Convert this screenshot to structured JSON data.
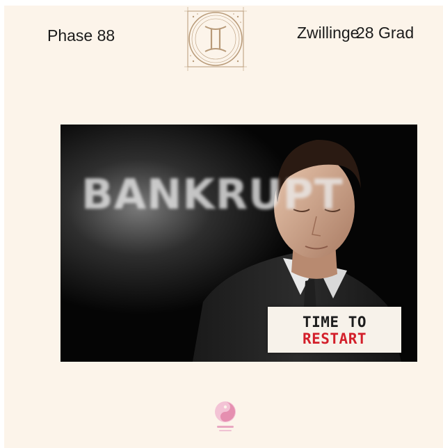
{
  "header": {
    "phase": "Phase 88",
    "sign": "Zwillinge",
    "degree": "28 Grad",
    "emblem_icon": "gemini-zodiac-icon"
  },
  "image": {
    "background_text": "BANKRUPT",
    "caption_line1": "TIME TO",
    "caption_line2": "RESTART"
  },
  "footer": {
    "logo_icon": "brand-logo-icon"
  },
  "colors": {
    "page_background": "#fcf4ea",
    "emblem": "#b89a78",
    "caption_red": "#d31f2a",
    "logo_pink": "#e58fb0"
  }
}
